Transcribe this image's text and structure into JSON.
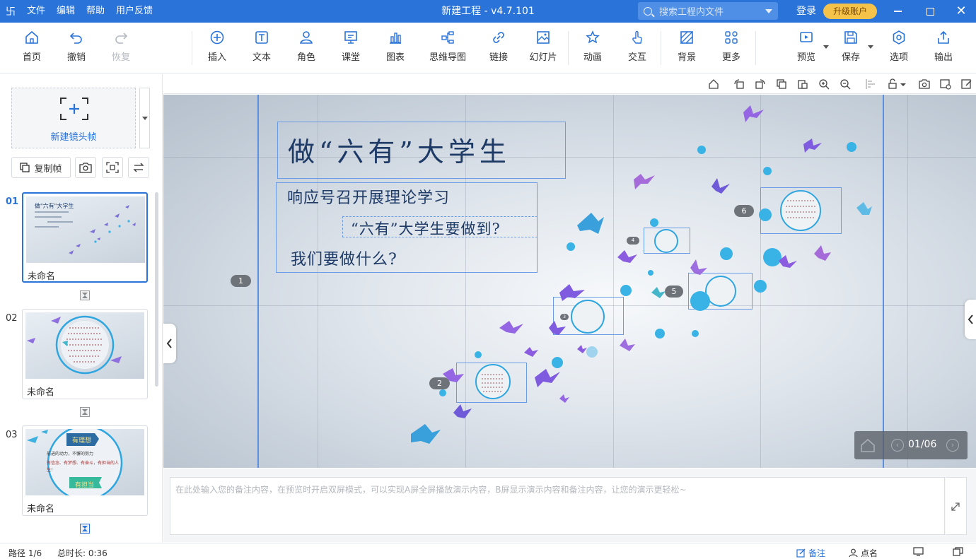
{
  "app": {
    "title": "新建工程 - v4.7.101",
    "menu": [
      "文件",
      "编辑",
      "帮助",
      "用户反馈"
    ],
    "search_placeholder": "搜索工程内文件",
    "login": "登录",
    "upgrade": "升级账户"
  },
  "toolbar": {
    "home": "首页",
    "undo": "撤销",
    "redo": "恢复",
    "insert": "插入",
    "text": "文本",
    "role": "角色",
    "classroom": "课堂",
    "chart": "图表",
    "mindmap": "思维导图",
    "link": "链接",
    "slides": "幻灯片",
    "animation": "动画",
    "interact": "交互",
    "background": "背景",
    "more": "更多",
    "preview": "预览",
    "save": "保存",
    "options": "选项",
    "export": "输出"
  },
  "left_panel": {
    "new_frame": "新建镜头帧",
    "copy_frame": "复制帧",
    "frames": [
      {
        "num": "01",
        "name": "未命名",
        "thumb_title": "做\"六有\"大学生"
      },
      {
        "num": "02",
        "name": "未命名"
      },
      {
        "num": "03",
        "name": "未命名",
        "thumb_title": "有理想",
        "thumb_line1": "前进的动力，不懈的努力",
        "thumb_line2": "有信念、有梦想、有奋斗，有担当的人生！",
        "thumb_tag": "有担当"
      }
    ]
  },
  "canvas": {
    "title": "做“六有”大学生",
    "line1": "响应号召开展理论学习",
    "line2": "“六有”大学生要做到?",
    "line3": "我们要做什么?",
    "badges": [
      "1",
      "2",
      "3",
      "4",
      "5",
      "6"
    ],
    "pager": "01/06"
  },
  "notes": {
    "placeholder": "在此处输入您的备注内容，在预览时开启双屏模式，可以实现A屏全屏播放演示内容，B屏显示演示内容和备注内容，让您的演示更轻松~"
  },
  "status": {
    "path": "路径 1/6",
    "duration": "总时长: 0:36",
    "notes_btn": "备注",
    "rollcall_btn": "点名"
  },
  "colors": {
    "brand": "#2a73d9",
    "upgrade": "#f6c34a",
    "accent_dots": "#39b3e6"
  }
}
